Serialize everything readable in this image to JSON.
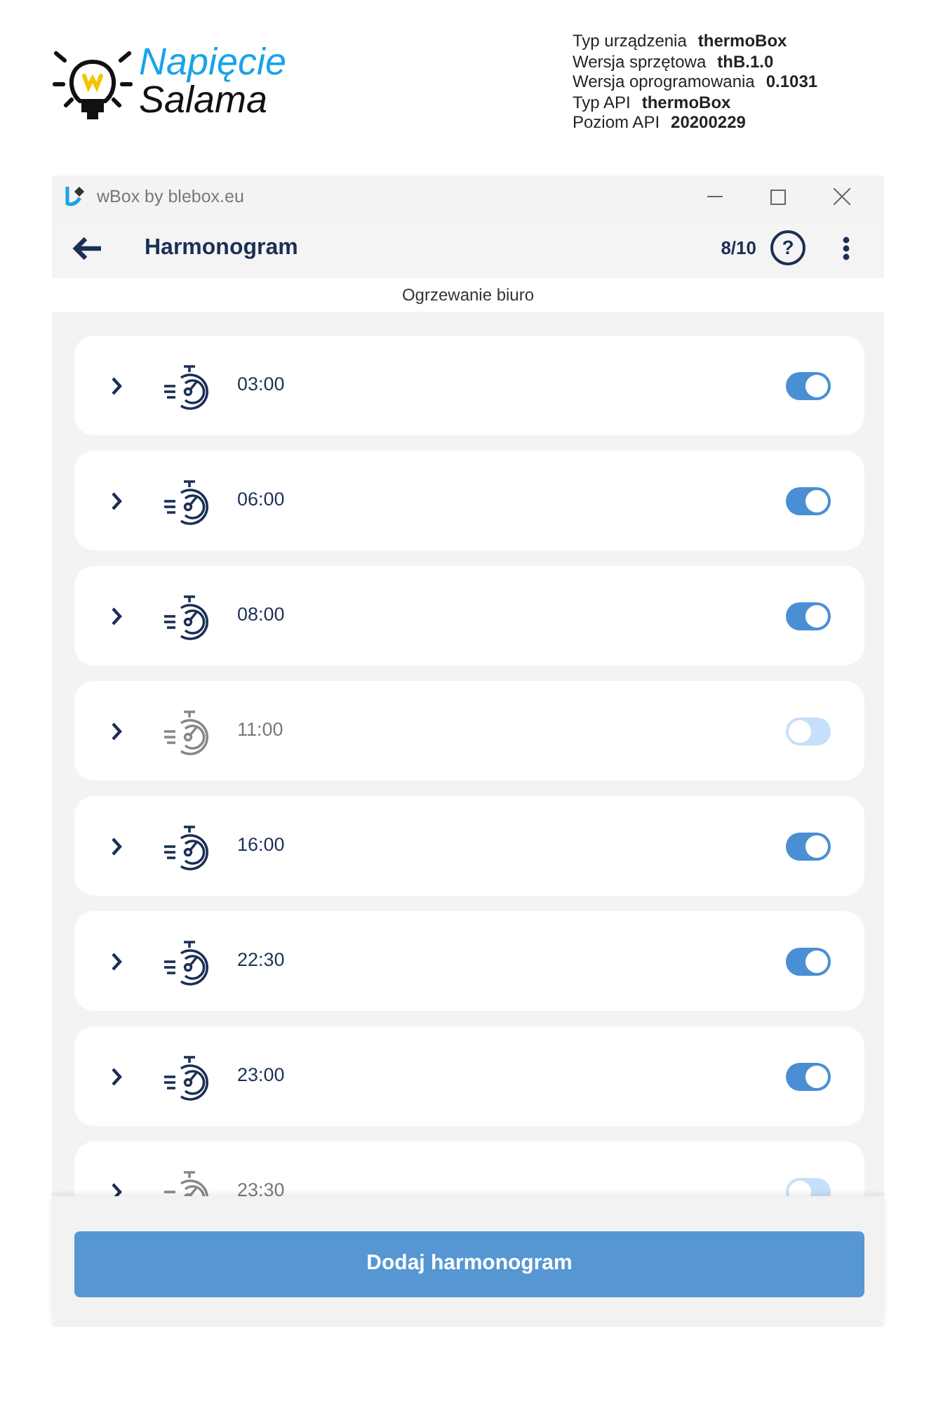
{
  "logo": {
    "line1": "Napięcie",
    "line2": "Salama"
  },
  "device_info": [
    {
      "label": "Typ urządzenia",
      "value": "thermoBox"
    },
    {
      "label": "Wersja sprzętowa",
      "value": "thB.1.0"
    },
    {
      "label": "Wersja oprogramowania",
      "value": "0.1031"
    },
    {
      "label": "Typ API",
      "value": "thermoBox"
    },
    {
      "label": "Poziom API",
      "value": "20200229"
    }
  ],
  "window": {
    "title": "wBox by blebox.eu"
  },
  "app_bar": {
    "title": "Harmonogram",
    "count": "8/10",
    "help": "?"
  },
  "subtitle": "Ogrzewanie biuro",
  "schedules": [
    {
      "time": "03:00",
      "on": true
    },
    {
      "time": "06:00",
      "on": true
    },
    {
      "time": "08:00",
      "on": true
    },
    {
      "time": "11:00",
      "on": false
    },
    {
      "time": "16:00",
      "on": true
    },
    {
      "time": "22:30",
      "on": true
    },
    {
      "time": "23:00",
      "on": true
    },
    {
      "time": "23:30",
      "on": false
    }
  ],
  "add_button": "Dodaj harmonogram"
}
